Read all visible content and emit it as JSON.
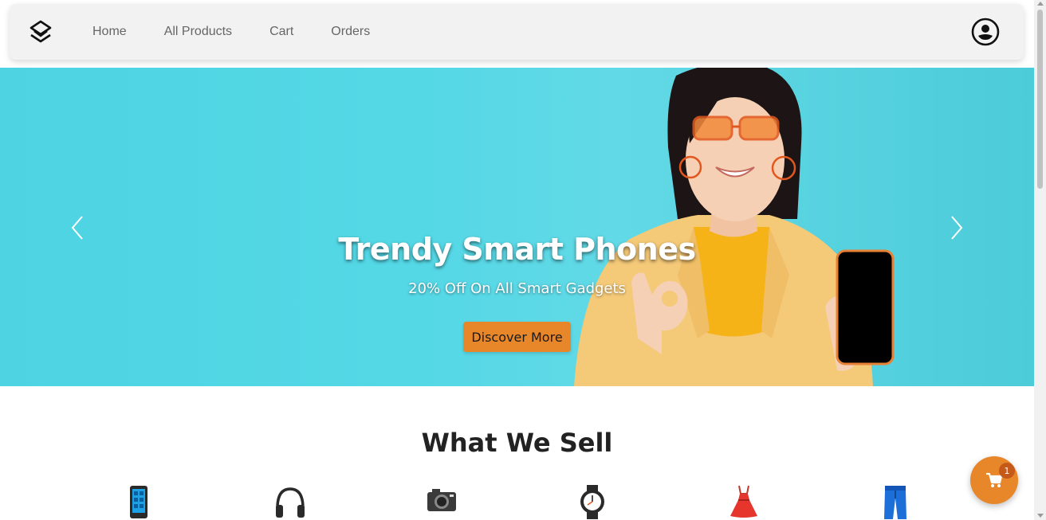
{
  "nav": {
    "logo_icon": "layers-logo-icon",
    "links": [
      "Home",
      "All Products",
      "Cart",
      "Orders"
    ],
    "profile_icon": "user-circle-icon"
  },
  "hero": {
    "title": "Trendy Smart Phones",
    "subtitle": "20% Off On All Smart Gadgets",
    "button_label": "Discover More",
    "prev_icon": "chevron-left-icon",
    "next_icon": "chevron-right-icon"
  },
  "section": {
    "title": "What We Sell",
    "categories": [
      {
        "icon": "mobile-phone-icon"
      },
      {
        "icon": "headphones-icon"
      },
      {
        "icon": "camera-icon"
      },
      {
        "icon": "watch-icon"
      },
      {
        "icon": "dress-icon"
      },
      {
        "icon": "jeans-icon"
      }
    ]
  },
  "cart_fab": {
    "icon": "shopping-cart-icon",
    "count": "1"
  },
  "colors": {
    "accent": "#e8862a",
    "hero_bg": "#54d8e6",
    "nav_bg": "#f2f2f2"
  }
}
